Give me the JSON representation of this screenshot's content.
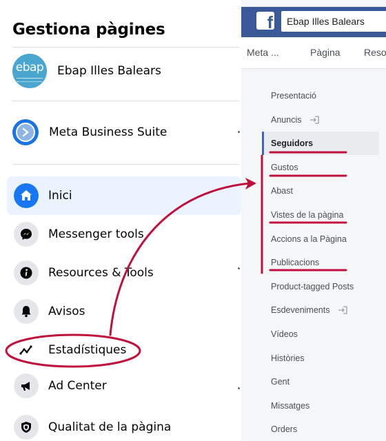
{
  "left_panel": {
    "title": "Gestiona pàgines",
    "page": {
      "name": "Ebap Illes Balears",
      "logo_text": "ebap"
    },
    "business_suite": {
      "label": "Meta Business Suite",
      "icon": "meta-business-suite-icon"
    },
    "menu": [
      {
        "label": "Inici",
        "icon": "home-icon",
        "active": true
      },
      {
        "label": "Messenger tools",
        "icon": "messenger-icon",
        "active": false
      },
      {
        "label": "Resources & Tools",
        "icon": "info-icon",
        "active": false
      },
      {
        "label": "Avisos",
        "icon": "bell-icon",
        "active": false
      },
      {
        "label": "Estadístiques",
        "icon": "insights-chart-icon",
        "active": false,
        "highlighted": true
      },
      {
        "label": "Ad Center",
        "icon": "megaphone-icon",
        "active": false
      },
      {
        "label": "Qualitat de la pàgina",
        "icon": "shield-icon",
        "active": false
      }
    ]
  },
  "right_panel": {
    "search_value": "Ebap Illes Balears",
    "tabs": [
      "Meta ...",
      "Pàgina",
      "Reso"
    ],
    "sidebar": [
      {
        "label": "Presentació",
        "selected": false,
        "external": false,
        "underlined": false
      },
      {
        "label": "Anuncis",
        "selected": false,
        "external": true,
        "underlined": false
      },
      {
        "label": "Seguidors",
        "selected": true,
        "external": false,
        "underlined": true
      },
      {
        "label": "Gustos",
        "selected": false,
        "external": false,
        "underlined": true
      },
      {
        "label": "Abast",
        "selected": false,
        "external": false,
        "underlined": false
      },
      {
        "label": "Vistes de la pàgina",
        "selected": false,
        "external": false,
        "underlined": true
      },
      {
        "label": "Accions a la Pàgina",
        "selected": false,
        "external": false,
        "underlined": false
      },
      {
        "label": "Publicacions",
        "selected": false,
        "external": false,
        "underlined": true
      },
      {
        "label": "Product-tagged Posts",
        "selected": false,
        "external": false,
        "underlined": false
      },
      {
        "label": "Esdeveniments",
        "selected": false,
        "external": true,
        "underlined": false
      },
      {
        "label": "Vídeos",
        "selected": false,
        "external": false,
        "underlined": false
      },
      {
        "label": "Històries",
        "selected": false,
        "external": false,
        "underlined": false
      },
      {
        "label": "Gent",
        "selected": false,
        "external": false,
        "underlined": false
      },
      {
        "label": "Missatges",
        "selected": false,
        "external": false,
        "underlined": false
      },
      {
        "label": "Orders",
        "selected": false,
        "external": false,
        "underlined": false
      }
    ]
  },
  "colors": {
    "facebook_blue": "#3b5998",
    "meta_blue": "#1877f2",
    "annotation_red": "#c0103c",
    "active_bg": "#ebf3ff"
  }
}
